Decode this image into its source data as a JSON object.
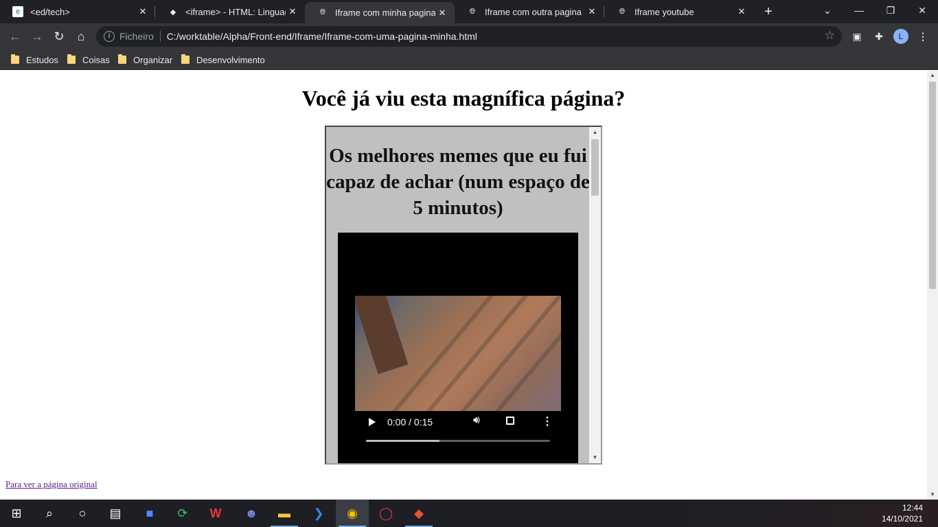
{
  "browser": {
    "tabs": [
      {
        "title": "<ed/tech>",
        "icon": "edtech-favicon",
        "active": false
      },
      {
        "title": "<iframe> - HTML: Linguagem",
        "icon": "mdn-favicon",
        "active": false
      },
      {
        "title": "Iframe com minha pagina",
        "icon": "globe-icon",
        "active": true
      },
      {
        "title": "Iframe com outra pagina",
        "icon": "globe-icon",
        "active": false
      },
      {
        "title": "Iframe youtube",
        "icon": "globe-icon",
        "active": false
      }
    ],
    "address": {
      "label": "Ficheiro",
      "url": "C:/worktable/Alpha/Front-end/Iframe/Iframe-com-uma-pagina-minha.html"
    },
    "profile_initial": "L",
    "bookmarks": [
      "Estudos",
      "Coisas",
      "Organizar",
      "Desenvolvimento"
    ]
  },
  "page": {
    "title": "Você já viu esta magnífica página?",
    "iframe": {
      "heading": "Os melhores memes que eu fui capaz de achar (num espaço de 5 minutos)",
      "video": {
        "time": "0:00 / 0:15",
        "progress": 0.4
      }
    },
    "link_text": "Para ver a página original"
  },
  "taskbar": {
    "time": "12:44",
    "date": "14/10/2021"
  },
  "colors": {
    "tabstrip": "#202124",
    "toolbar": "#35363a",
    "iframe_bg": "#c0c0c0",
    "link": "#551a8b"
  }
}
